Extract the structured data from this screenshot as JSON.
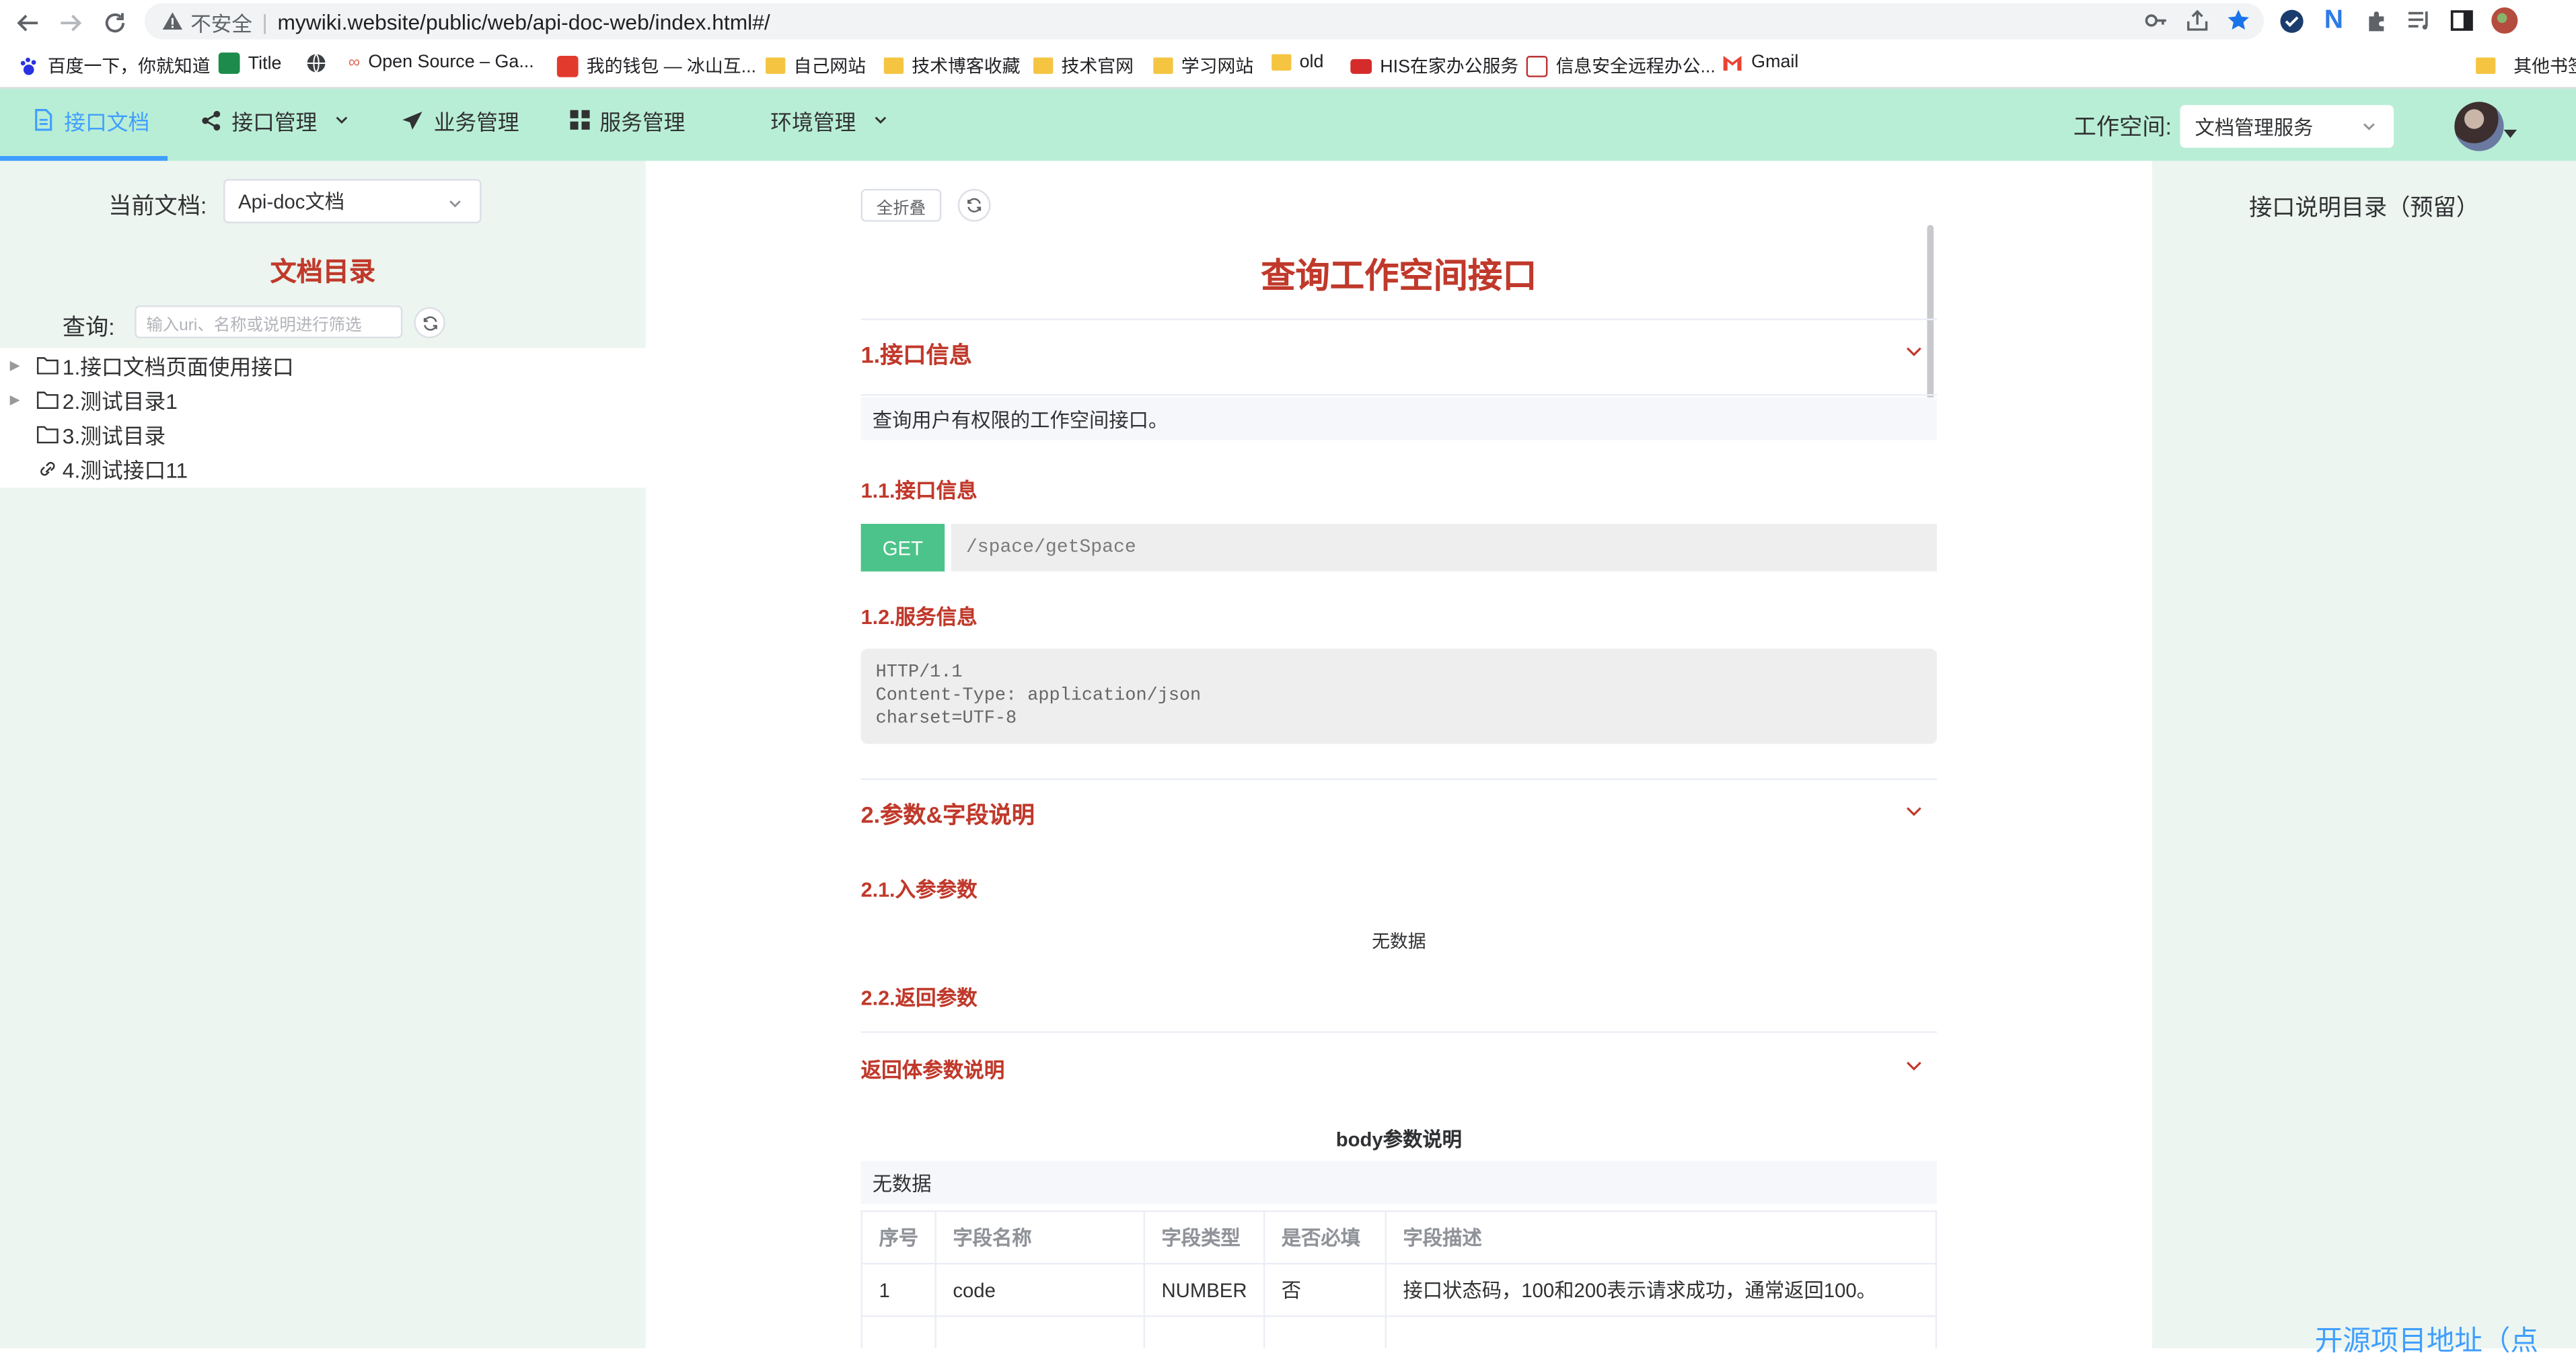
{
  "browser": {
    "insecure_label": "不安全",
    "url": "mywiki.website/public/web/api-doc-web/index.html#/",
    "bookmarks": [
      {
        "label": "百度一下，你就知道",
        "icon": "baidu-icon"
      },
      {
        "label": "Title",
        "icon": "page-icon"
      },
      {
        "label": "",
        "icon": "globe-icon"
      },
      {
        "label": "Open Source – Ga...",
        "icon": "opensource-icon"
      },
      {
        "label": "我的钱包 — 冰山互...",
        "icon": "wallet-icon"
      },
      {
        "label": "自己网站",
        "icon": "folder-icon"
      },
      {
        "label": "技术博客收藏",
        "icon": "folder-icon"
      },
      {
        "label": "技术官网",
        "icon": "folder-icon"
      },
      {
        "label": "学习网站",
        "icon": "folder-icon"
      },
      {
        "label": "old",
        "icon": "folder-icon"
      },
      {
        "label": "HIS在家办公服务",
        "icon": "his-icon"
      },
      {
        "label": "信息安全远程办公...",
        "icon": "security-icon"
      },
      {
        "label": "Gmail",
        "icon": "gmail-icon"
      },
      {
        "label": "其他书签",
        "icon": "folder-icon"
      }
    ]
  },
  "nav": {
    "items": [
      {
        "label": "接口文档",
        "icon": "document-icon",
        "active": true,
        "has_dropdown": false
      },
      {
        "label": "接口管理",
        "icon": "share-icon",
        "active": false,
        "has_dropdown": true
      },
      {
        "label": "业务管理",
        "icon": "send-icon",
        "active": false,
        "has_dropdown": false
      },
      {
        "label": "服务管理",
        "icon": "grid-icon",
        "active": false,
        "has_dropdown": false
      },
      {
        "label": "环境管理",
        "icon": "",
        "active": false,
        "has_dropdown": true
      }
    ],
    "workspace_label": "工作空间:",
    "workspace_value": "文档管理服务"
  },
  "sidebar": {
    "current_doc_label": "当前文档:",
    "current_doc_value": "Api-doc文档",
    "toc_title": "文档目录",
    "query_label": "查询:",
    "query_placeholder": "输入uri、名称或说明进行筛选",
    "tree": [
      {
        "label": "1.接口文档页面使用接口",
        "type": "folder",
        "expandable": true
      },
      {
        "label": "2.测试目录1",
        "type": "folder",
        "expandable": true
      },
      {
        "label": "3.测试目录",
        "type": "folder",
        "expandable": false
      },
      {
        "label": "4.测试接口11",
        "type": "link",
        "expandable": false
      }
    ]
  },
  "main": {
    "collapse_all_label": "全折叠",
    "title": "查询工作空间接口",
    "sections": {
      "info_title": "1.接口信息",
      "description": "查询用户有权限的工作空间接口。",
      "api_info_title": "1.1.接口信息",
      "method": "GET",
      "path": "/space/getSpace",
      "service_info_title": "1.2.服务信息",
      "service_lines": [
        "HTTP/1.1",
        "Content-Type: application/json",
        "charset=UTF-8"
      ],
      "params_title": "2.参数&字段说明",
      "input_params_title": "2.1.入参参数",
      "input_params_empty": "无数据",
      "return_params_title": "2.2.返回参数",
      "return_body_title": "返回体参数说明",
      "body_params_title": "body参数说明",
      "body_params_empty": "无数据"
    },
    "table": {
      "headers": [
        "序号",
        "字段名称",
        "字段类型",
        "是否必填",
        "字段描述"
      ],
      "rows": [
        [
          "1",
          "code",
          "NUMBER",
          "否",
          "接口状态码，100和200表示请求成功，通常返回100。"
        ]
      ]
    }
  },
  "right_panel": {
    "title": "接口说明目录（预留）"
  },
  "footer": {
    "link_label": "开源项目地址（点我）"
  },
  "colors": {
    "nav_bg": "#b9eed6",
    "side_bg": "#ecf5ef",
    "accent": "#409eff",
    "title_red": "#c0392b",
    "get_green": "#4cc38a"
  }
}
